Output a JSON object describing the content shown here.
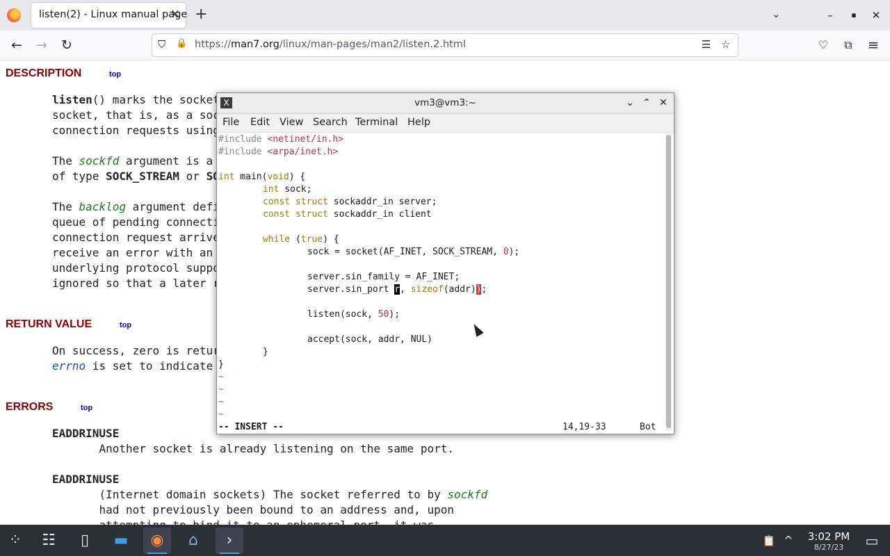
{
  "browser": {
    "tab_title": "listen(2) - Linux manual page",
    "tab_close": "✕",
    "new_tab": "+",
    "list_tabs": "⌄",
    "url_prefix": "https://",
    "url_host": "man7.org",
    "url_path": "/linux/man-pages/man2/listen.2.html",
    "window_buttons": {
      "minimize": "–",
      "maximize": "▪",
      "close": "✕"
    },
    "nav": {
      "back": "←",
      "forward": "→",
      "reload": "↻",
      "shield": "⛉",
      "lock": "🔒",
      "reader": "☰",
      "bookmark": "☆",
      "pocket": "♡",
      "extensions": "⧉",
      "menu": "≡"
    }
  },
  "manpage": {
    "top_label": "top",
    "description": {
      "heading": "DESCRIPTION",
      "p1": [
        "listen",
        "() marks the socket",
        "socket, that is, as a soc",
        "connection requests using"
      ],
      "p2_a": "The ",
      "p2_arg": "sockfd",
      "p2_b": " argument is a",
      "p2_line2_a": "of type ",
      "p2_line2_b": "SOCK_STREAM",
      "p2_line2_c": " or ",
      "p2_line2_d": "SO",
      "p3_a": "The ",
      "p3_arg": "backlog",
      "p3_b": " argument defi",
      "p3_lines": [
        "queue of pending connecti",
        "connection request arrive",
        "receive an error with an",
        "underlying protocol suppo",
        "ignored so that a later r"
      ]
    },
    "return_value": {
      "heading": "RETURN VALUE",
      "line1": "On success, zero is retur",
      "line2_a": "errno",
      "line2_b": " is set to indicate"
    },
    "errors": {
      "heading": "ERRORS",
      "e1_name": "EADDRINUSE",
      "e1_text": "Another socket is already listening on the same port.",
      "e2_name": "EADDRINUSE",
      "e2_a": "(Internet domain sockets) The socket referred to by ",
      "e2_arg": "sockfd",
      "e2_line2": "had not previously been bound to an address and, upon",
      "e2_line3": "attempting to bind it to an ephemeral port, it was"
    }
  },
  "terminal": {
    "title": "vm3@vm3:~",
    "icon": "X",
    "buttons": {
      "minimize": "⌄",
      "maximize": "⌃",
      "close": "✕"
    },
    "menu": [
      "File",
      "Edit",
      "View",
      "Search",
      "Terminal",
      "Help"
    ],
    "code": {
      "inc1_kw": "#include",
      "inc1_file": " <netinet/in.h>",
      "inc2_kw": "#include",
      "inc2_file": " <arpa/inet.h>",
      "main_type": "int",
      "main_sig": " main(",
      "main_void": "void",
      "main_end": ") {",
      "l_int": "int",
      "l_sock": " sock;",
      "l_const1": "const struct",
      "l_server": " sockaddr_in server;",
      "l_const2": "const struct",
      "l_client": " sockaddr_in client",
      "l_while": "while",
      "l_while_a": " (",
      "l_true": "true",
      "l_while_b": ") {",
      "l_socket_a": "sock = socket(AF_INET, SOCK_STREAM, ",
      "l_socket_zero": "0",
      "l_socket_b": ");",
      "l_family": "server.sin_family = AF_INET;",
      "l_port_a": "server.sin_port ",
      "l_port_cur": "r",
      "l_port_b": ", ",
      "l_sizeof": "sizeof",
      "l_port_c": "(addr)",
      "l_port_paren": ")",
      "l_port_d": ";",
      "l_listen_a": "listen(sock, ",
      "l_listen_num": "50",
      "l_listen_b": ");",
      "l_accept": "accept(sock, addr, NUL)",
      "l_close_inner": "}",
      "l_close_outer": "}",
      "tilde": "~"
    },
    "status_mode": "-- INSERT --",
    "status_pos": "14,19-33",
    "status_scroll": "Bot"
  },
  "taskbar": {
    "launcher": "⁘",
    "settings": "☷",
    "files": "▯",
    "folder": "▬",
    "firefox": "◉",
    "home": "⌂",
    "terminal": "›",
    "clipboard": "📋",
    "tray_arrow": "^",
    "time": "3:02 PM",
    "date": "8/27/23",
    "desktop": "▭"
  }
}
